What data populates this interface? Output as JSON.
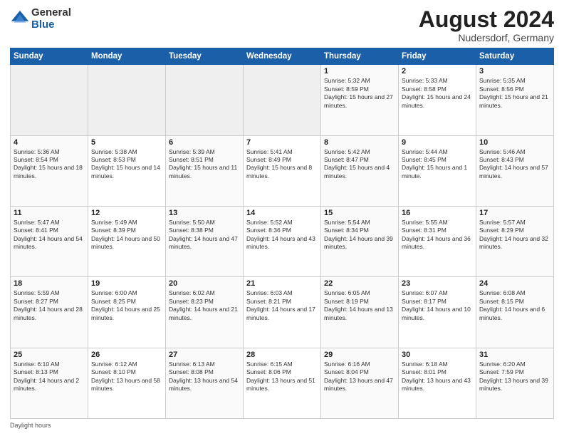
{
  "logo": {
    "general": "General",
    "blue": "Blue"
  },
  "header": {
    "month_year": "August 2024",
    "location": "Nudersdorf, Germany"
  },
  "days_of_week": [
    "Sunday",
    "Monday",
    "Tuesday",
    "Wednesday",
    "Thursday",
    "Friday",
    "Saturday"
  ],
  "footer": {
    "daylight_label": "Daylight hours"
  },
  "weeks": [
    [
      {
        "day": "",
        "empty": true
      },
      {
        "day": "",
        "empty": true
      },
      {
        "day": "",
        "empty": true
      },
      {
        "day": "",
        "empty": true
      },
      {
        "day": "1",
        "sunrise": "5:32 AM",
        "sunset": "8:59 PM",
        "daylight": "15 hours and 27 minutes."
      },
      {
        "day": "2",
        "sunrise": "5:33 AM",
        "sunset": "8:58 PM",
        "daylight": "15 hours and 24 minutes."
      },
      {
        "day": "3",
        "sunrise": "5:35 AM",
        "sunset": "8:56 PM",
        "daylight": "15 hours and 21 minutes."
      }
    ],
    [
      {
        "day": "4",
        "sunrise": "5:36 AM",
        "sunset": "8:54 PM",
        "daylight": "15 hours and 18 minutes."
      },
      {
        "day": "5",
        "sunrise": "5:38 AM",
        "sunset": "8:53 PM",
        "daylight": "15 hours and 14 minutes."
      },
      {
        "day": "6",
        "sunrise": "5:39 AM",
        "sunset": "8:51 PM",
        "daylight": "15 hours and 11 minutes."
      },
      {
        "day": "7",
        "sunrise": "5:41 AM",
        "sunset": "8:49 PM",
        "daylight": "15 hours and 8 minutes."
      },
      {
        "day": "8",
        "sunrise": "5:42 AM",
        "sunset": "8:47 PM",
        "daylight": "15 hours and 4 minutes."
      },
      {
        "day": "9",
        "sunrise": "5:44 AM",
        "sunset": "8:45 PM",
        "daylight": "15 hours and 1 minute."
      },
      {
        "day": "10",
        "sunrise": "5:46 AM",
        "sunset": "8:43 PM",
        "daylight": "14 hours and 57 minutes."
      }
    ],
    [
      {
        "day": "11",
        "sunrise": "5:47 AM",
        "sunset": "8:41 PM",
        "daylight": "14 hours and 54 minutes."
      },
      {
        "day": "12",
        "sunrise": "5:49 AM",
        "sunset": "8:39 PM",
        "daylight": "14 hours and 50 minutes."
      },
      {
        "day": "13",
        "sunrise": "5:50 AM",
        "sunset": "8:38 PM",
        "daylight": "14 hours and 47 minutes."
      },
      {
        "day": "14",
        "sunrise": "5:52 AM",
        "sunset": "8:36 PM",
        "daylight": "14 hours and 43 minutes."
      },
      {
        "day": "15",
        "sunrise": "5:54 AM",
        "sunset": "8:34 PM",
        "daylight": "14 hours and 39 minutes."
      },
      {
        "day": "16",
        "sunrise": "5:55 AM",
        "sunset": "8:31 PM",
        "daylight": "14 hours and 36 minutes."
      },
      {
        "day": "17",
        "sunrise": "5:57 AM",
        "sunset": "8:29 PM",
        "daylight": "14 hours and 32 minutes."
      }
    ],
    [
      {
        "day": "18",
        "sunrise": "5:59 AM",
        "sunset": "8:27 PM",
        "daylight": "14 hours and 28 minutes."
      },
      {
        "day": "19",
        "sunrise": "6:00 AM",
        "sunset": "8:25 PM",
        "daylight": "14 hours and 25 minutes."
      },
      {
        "day": "20",
        "sunrise": "6:02 AM",
        "sunset": "8:23 PM",
        "daylight": "14 hours and 21 minutes."
      },
      {
        "day": "21",
        "sunrise": "6:03 AM",
        "sunset": "8:21 PM",
        "daylight": "14 hours and 17 minutes."
      },
      {
        "day": "22",
        "sunrise": "6:05 AM",
        "sunset": "8:19 PM",
        "daylight": "14 hours and 13 minutes."
      },
      {
        "day": "23",
        "sunrise": "6:07 AM",
        "sunset": "8:17 PM",
        "daylight": "14 hours and 10 minutes."
      },
      {
        "day": "24",
        "sunrise": "6:08 AM",
        "sunset": "8:15 PM",
        "daylight": "14 hours and 6 minutes."
      }
    ],
    [
      {
        "day": "25",
        "sunrise": "6:10 AM",
        "sunset": "8:13 PM",
        "daylight": "14 hours and 2 minutes."
      },
      {
        "day": "26",
        "sunrise": "6:12 AM",
        "sunset": "8:10 PM",
        "daylight": "13 hours and 58 minutes."
      },
      {
        "day": "27",
        "sunrise": "6:13 AM",
        "sunset": "8:08 PM",
        "daylight": "13 hours and 54 minutes."
      },
      {
        "day": "28",
        "sunrise": "6:15 AM",
        "sunset": "8:06 PM",
        "daylight": "13 hours and 51 minutes."
      },
      {
        "day": "29",
        "sunrise": "6:16 AM",
        "sunset": "8:04 PM",
        "daylight": "13 hours and 47 minutes."
      },
      {
        "day": "30",
        "sunrise": "6:18 AM",
        "sunset": "8:01 PM",
        "daylight": "13 hours and 43 minutes."
      },
      {
        "day": "31",
        "sunrise": "6:20 AM",
        "sunset": "7:59 PM",
        "daylight": "13 hours and 39 minutes."
      }
    ]
  ]
}
